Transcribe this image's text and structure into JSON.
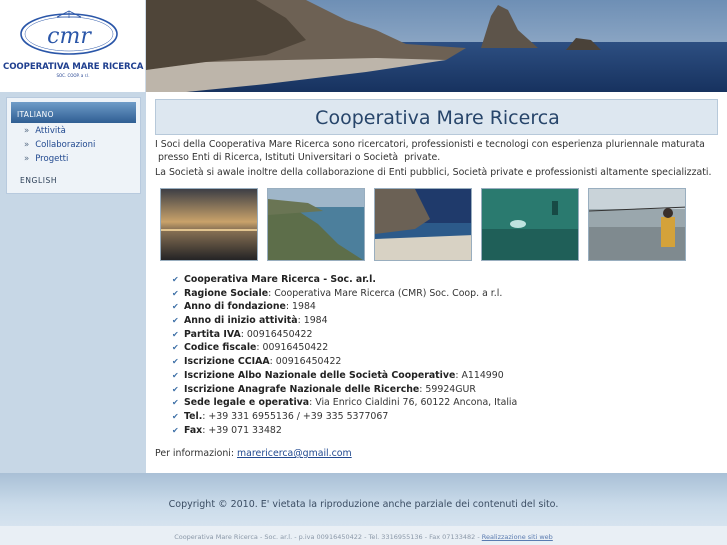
{
  "logo": {
    "name": "COOPERATIVA MARE RICERCA",
    "mark": "cmr",
    "sub": "SOC. COOP. a r.l."
  },
  "sidebar": {
    "lang_it": "ITALIANO",
    "items": [
      {
        "label": "Attività"
      },
      {
        "label": "Collaborazioni"
      },
      {
        "label": "Progetti"
      }
    ],
    "lang_en": "ENGLISH",
    "bullet": "»"
  },
  "main": {
    "title": "Cooperativa Mare Ricerca",
    "intro1_line1": "I Soci della Cooperativa Mare Ricerca sono ricercatori, professionisti e tecnologi con esperienza pluriennale  maturata",
    "intro1_line2": " presso Enti di Ricerca, Istituti Universitari o Società  private.",
    "intro2": "La Società si awale inoltre della collaborazione di Enti pubblici, Società private e professionisti altamente specializzati.",
    "facts": [
      {
        "label": "Cooperativa Mare Ricerca - Soc. ar.l.",
        "value": ""
      },
      {
        "label": "Ragione Sociale",
        "value": ": Cooperativa Mare Ricerca (CMR) Soc. Coop. a r.l."
      },
      {
        "label": "Anno di fondazione",
        "value": ": 1984"
      },
      {
        "label": "Anno di inizio attività",
        "value": ": 1984"
      },
      {
        "label": "Partita IVA",
        "value": ": 00916450422"
      },
      {
        "label": "Codice fiscale",
        "value": ": 00916450422"
      },
      {
        "label": "Iscrizione CCIAA",
        "value": ": 00916450422"
      },
      {
        "label": "Iscrizione Albo Nazionale delle Società Cooperative",
        "value": ": A114990"
      },
      {
        "label": "Iscrizione Anagrafe Nazionale delle Ricerche",
        "value": ": 59924GUR"
      },
      {
        "label": "Sede legale e operativa",
        "value": ": Via Enrico Cialdini 76, 60122 Ancona, Italia"
      },
      {
        "label": "Tel.",
        "value": ": +39 331 6955136 / +39 335 5377067"
      },
      {
        "label": "Fax",
        "value": ": +39 071 33482"
      }
    ],
    "info_label": "Per informazioni: ",
    "info_email": "marericerca@gmail.com"
  },
  "footer": {
    "copyright": "Copyright © 2010. E' vietata la riproduzione anche parziale dei contenuti del sito.",
    "bottom_text": "Cooperativa Mare Ricerca - Soc. ar.l. - p.iva 00916450422 - Tel. 3316955136 - Fax 07133482 - ",
    "bottom_link": "Realizzazione siti web"
  },
  "colors": {
    "accent": "#27456a",
    "link": "#224a90",
    "check": "#3d6fa6",
    "background": "#c7d7e6"
  }
}
